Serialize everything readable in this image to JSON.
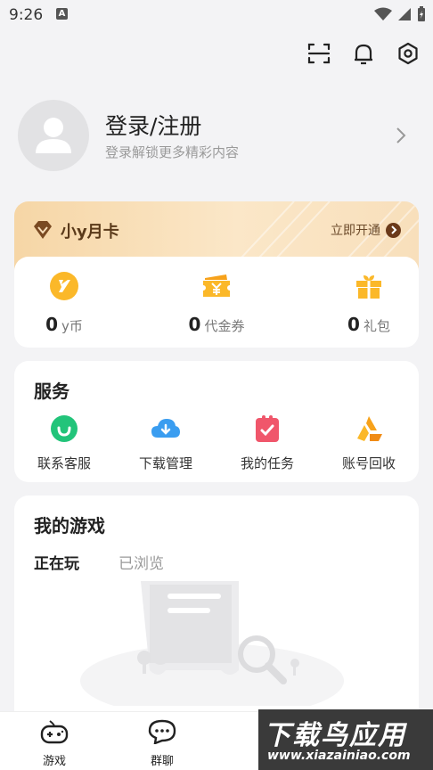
{
  "status_bar": {
    "time": "9:26",
    "notification_letter": "A"
  },
  "profile": {
    "title": "登录/注册",
    "subtitle": "登录解锁更多精彩内容"
  },
  "vip_card": {
    "title": "小y月卡",
    "action": "立即开通"
  },
  "wallet": {
    "items": [
      {
        "value": "0",
        "unit": "y币",
        "icon": "y-coin-icon"
      },
      {
        "value": "0",
        "unit": "代金券",
        "icon": "voucher-icon"
      },
      {
        "value": "0",
        "unit": "礼包",
        "icon": "gift-icon"
      }
    ]
  },
  "services": {
    "title": "服务",
    "items": [
      {
        "label": "联系客服",
        "icon": "customer-service-icon"
      },
      {
        "label": "下载管理",
        "icon": "download-cloud-icon"
      },
      {
        "label": "我的任务",
        "icon": "task-clipboard-icon"
      },
      {
        "label": "账号回收",
        "icon": "recycle-icon"
      }
    ]
  },
  "my_games": {
    "title": "我的游戏",
    "tabs": [
      "正在玩",
      "已浏览"
    ],
    "active_tab": "正在玩"
  },
  "bottom_nav": {
    "items": [
      {
        "label": "游戏",
        "icon": "gamepad-icon"
      },
      {
        "label": "群聊",
        "icon": "chat-icon"
      }
    ]
  },
  "watermark": {
    "text": "下载鸟应用",
    "url": "www.xiazainiao.com"
  },
  "colors": {
    "accent_yellow": "#ffd84a",
    "vip_brown": "#6b3a1a",
    "background": "#f3f3f5"
  }
}
